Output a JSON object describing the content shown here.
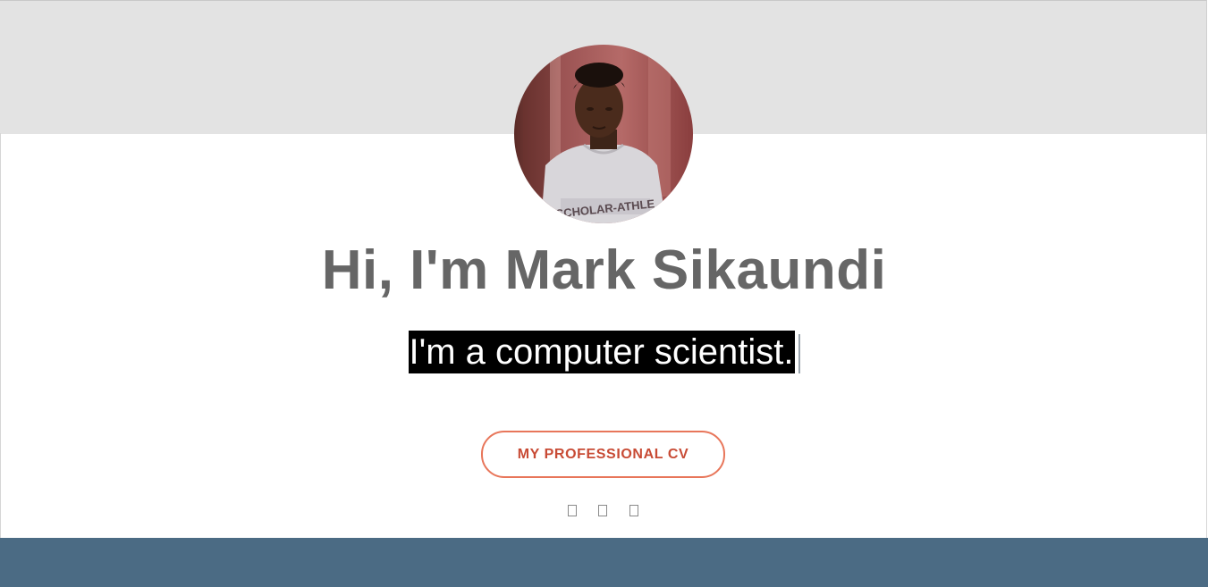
{
  "hero": {
    "headline": "Hi, I'm Mark Sikaundi",
    "typed_text": "I'm a computer scientist.",
    "cv_button_label": "MY PROFESSIONAL CV"
  },
  "social_links": [
    {
      "icon": "social-icon-1"
    },
    {
      "icon": "social-icon-2"
    },
    {
      "icon": "social-icon-3"
    }
  ],
  "colors": {
    "top_band": "#e3e3e3",
    "headline": "#666666",
    "button_border": "#e8765a",
    "button_text": "#c84b35",
    "bottom_band": "#4b6b84"
  }
}
